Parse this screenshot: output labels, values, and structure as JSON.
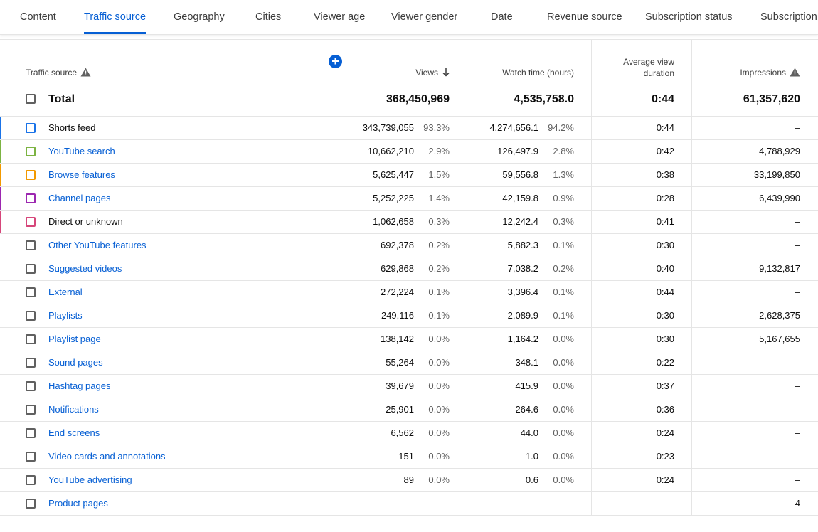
{
  "tabs": [
    {
      "label": "Content",
      "active": false
    },
    {
      "label": "Traffic source",
      "active": true
    },
    {
      "label": "Geography",
      "active": false
    },
    {
      "label": "Cities",
      "active": false
    },
    {
      "label": "Viewer age",
      "active": false
    },
    {
      "label": "Viewer gender",
      "active": false
    },
    {
      "label": "Date",
      "active": false
    },
    {
      "label": "Revenue source",
      "active": false
    },
    {
      "label": "Subscription status",
      "active": false
    },
    {
      "label": "Subscription",
      "active": false
    }
  ],
  "table": {
    "headers": {
      "source": "Traffic source",
      "views": "Views",
      "watch_time": "Watch time (hours)",
      "avg_duration_line1": "Average view",
      "avg_duration_line2": "duration",
      "impressions": "Impressions"
    },
    "total": {
      "label": "Total",
      "views": "368,450,969",
      "watch_time": "4,535,758.0",
      "avg_duration": "0:44",
      "impressions": "61,357,620"
    },
    "rows": [
      {
        "label": "Shorts feed",
        "link": false,
        "color": "#1a73e8",
        "views": "343,739,055",
        "views_pct": "93.3%",
        "watch": "4,274,656.1",
        "watch_pct": "94.2%",
        "avg": "0:44",
        "impressions": "–"
      },
      {
        "label": "YouTube search",
        "link": true,
        "color": "#7cb342",
        "views": "10,662,210",
        "views_pct": "2.9%",
        "watch": "126,497.9",
        "watch_pct": "2.8%",
        "avg": "0:42",
        "impressions": "4,788,929"
      },
      {
        "label": "Browse features",
        "link": true,
        "color": "#f29900",
        "views": "5,625,447",
        "views_pct": "1.5%",
        "watch": "59,556.8",
        "watch_pct": "1.3%",
        "avg": "0:38",
        "impressions": "33,199,850"
      },
      {
        "label": "Channel pages",
        "link": true,
        "color": "#9c27b0",
        "views": "5,252,225",
        "views_pct": "1.4%",
        "watch": "42,159.8",
        "watch_pct": "0.9%",
        "avg": "0:28",
        "impressions": "6,439,990"
      },
      {
        "label": "Direct or unknown",
        "link": false,
        "color": "#d6467a",
        "views": "1,062,658",
        "views_pct": "0.3%",
        "watch": "12,242.4",
        "watch_pct": "0.3%",
        "avg": "0:41",
        "impressions": "–"
      },
      {
        "label": "Other YouTube features",
        "link": true,
        "color": "",
        "views": "692,378",
        "views_pct": "0.2%",
        "watch": "5,882.3",
        "watch_pct": "0.1%",
        "avg": "0:30",
        "impressions": "–"
      },
      {
        "label": "Suggested videos",
        "link": true,
        "color": "",
        "views": "629,868",
        "views_pct": "0.2%",
        "watch": "7,038.2",
        "watch_pct": "0.2%",
        "avg": "0:40",
        "impressions": "9,132,817"
      },
      {
        "label": "External",
        "link": true,
        "color": "",
        "views": "272,224",
        "views_pct": "0.1%",
        "watch": "3,396.4",
        "watch_pct": "0.1%",
        "avg": "0:44",
        "impressions": "–"
      },
      {
        "label": "Playlists",
        "link": true,
        "color": "",
        "views": "249,116",
        "views_pct": "0.1%",
        "watch": "2,089.9",
        "watch_pct": "0.1%",
        "avg": "0:30",
        "impressions": "2,628,375"
      },
      {
        "label": "Playlist page",
        "link": true,
        "color": "",
        "views": "138,142",
        "views_pct": "0.0%",
        "watch": "1,164.2",
        "watch_pct": "0.0%",
        "avg": "0:30",
        "impressions": "5,167,655"
      },
      {
        "label": "Sound pages",
        "link": true,
        "color": "",
        "views": "55,264",
        "views_pct": "0.0%",
        "watch": "348.1",
        "watch_pct": "0.0%",
        "avg": "0:22",
        "impressions": "–"
      },
      {
        "label": "Hashtag pages",
        "link": true,
        "color": "",
        "views": "39,679",
        "views_pct": "0.0%",
        "watch": "415.9",
        "watch_pct": "0.0%",
        "avg": "0:37",
        "impressions": "–"
      },
      {
        "label": "Notifications",
        "link": true,
        "color": "",
        "views": "25,901",
        "views_pct": "0.0%",
        "watch": "264.6",
        "watch_pct": "0.0%",
        "avg": "0:36",
        "impressions": "–"
      },
      {
        "label": "End screens",
        "link": true,
        "color": "",
        "views": "6,562",
        "views_pct": "0.0%",
        "watch": "44.0",
        "watch_pct": "0.0%",
        "avg": "0:24",
        "impressions": "–"
      },
      {
        "label": "Video cards and annotations",
        "link": true,
        "color": "",
        "views": "151",
        "views_pct": "0.0%",
        "watch": "1.0",
        "watch_pct": "0.0%",
        "avg": "0:23",
        "impressions": "–"
      },
      {
        "label": "YouTube advertising",
        "link": true,
        "color": "",
        "views": "89",
        "views_pct": "0.0%",
        "watch": "0.6",
        "watch_pct": "0.0%",
        "avg": "0:24",
        "impressions": "–"
      },
      {
        "label": "Product pages",
        "link": true,
        "color": "",
        "views": "–",
        "views_pct": "–",
        "watch": "–",
        "watch_pct": "–",
        "avg": "–",
        "impressions": "4"
      }
    ]
  }
}
